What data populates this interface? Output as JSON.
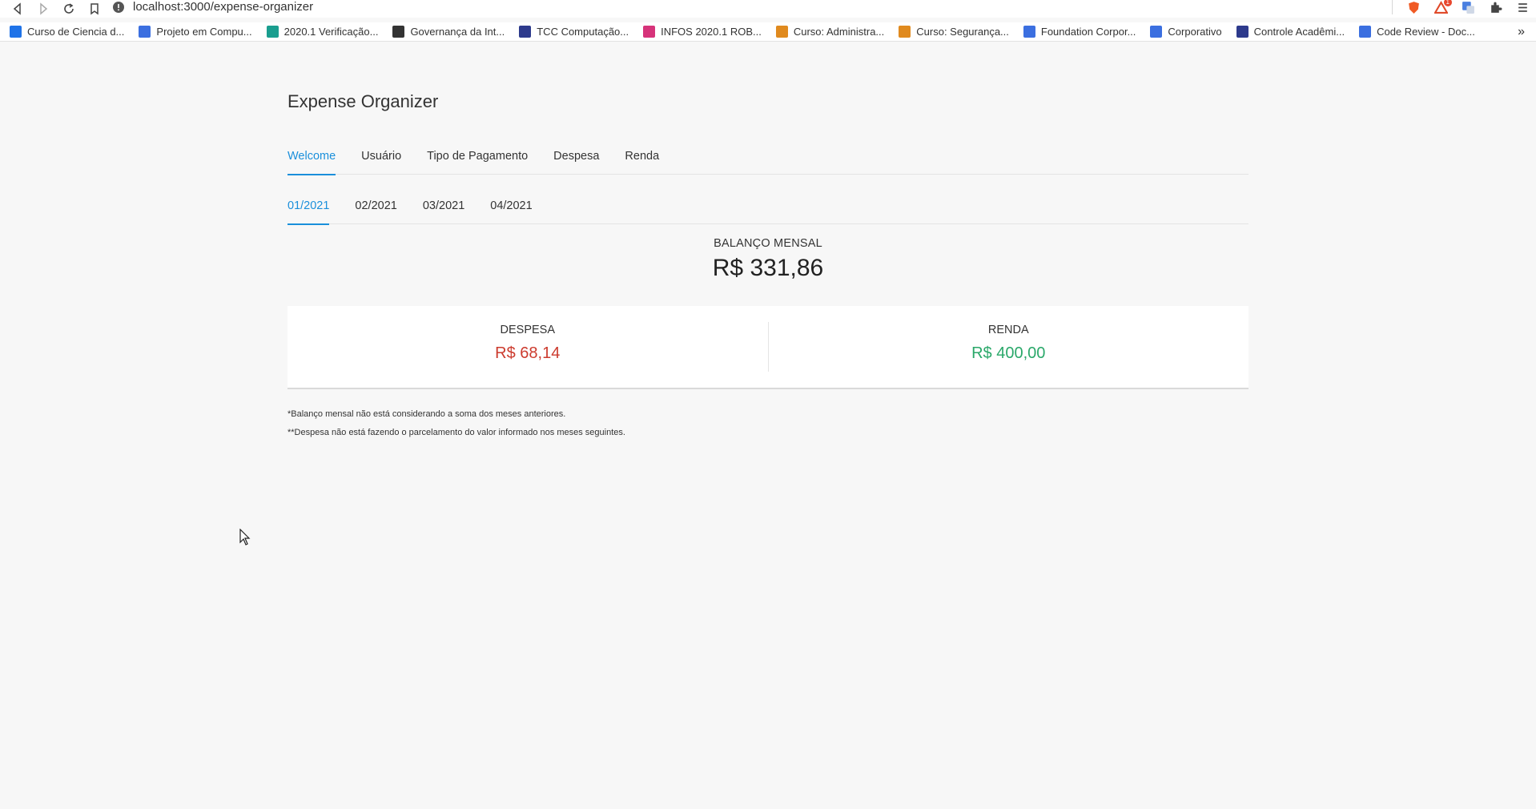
{
  "browser": {
    "url": "localhost:3000/expense-organizer",
    "bookmarks": [
      {
        "label": "Curso de Ciencia d...",
        "color": "#1f73e8"
      },
      {
        "label": "Projeto em Compu...",
        "color": "#3b6fe0"
      },
      {
        "label": "2020.1 Verificação...",
        "color": "#1a9e8f"
      },
      {
        "label": "Governança da Int...",
        "color": "#333333"
      },
      {
        "label": "TCC Computação...",
        "color": "#2d3a8c"
      },
      {
        "label": "INFOS 2020.1 ROB...",
        "color": "#d6337a"
      },
      {
        "label": "Curso: Administra...",
        "color": "#e08a1e"
      },
      {
        "label": "Curso: Segurança...",
        "color": "#e08a1e"
      },
      {
        "label": "Foundation Corpor...",
        "color": "#3b6fe0"
      },
      {
        "label": "Corporativo",
        "color": "#3b6fe0"
      },
      {
        "label": "Controle Acadêmi...",
        "color": "#2d3a8c"
      },
      {
        "label": "Code Review - Doc...",
        "color": "#3b6fe0"
      }
    ],
    "more": "»",
    "badge": "1"
  },
  "app": {
    "title": "Expense Organizer",
    "tabs": [
      "Welcome",
      "Usuário",
      "Tipo de Pagamento",
      "Despesa",
      "Renda"
    ],
    "active_tab": "Welcome",
    "months": [
      "01/2021",
      "02/2021",
      "03/2021",
      "04/2021"
    ],
    "active_month": "01/2021",
    "balance": {
      "label": "BALANÇO MENSAL",
      "value": "R$ 331,86"
    },
    "summary": {
      "expense_label": "DESPESA",
      "expense_value": "R$ 68,14",
      "income_label": "RENDA",
      "income_value": "R$ 400,00"
    },
    "notes": [
      "*Balanço mensal não está considerando a soma dos meses anteriores.",
      "**Despesa não está fazendo o parcelamento do valor informado nos meses seguintes."
    ]
  },
  "colors": {
    "accent": "#1a8fdb",
    "expense": "#cc3b2e",
    "income": "#2aa86a"
  }
}
